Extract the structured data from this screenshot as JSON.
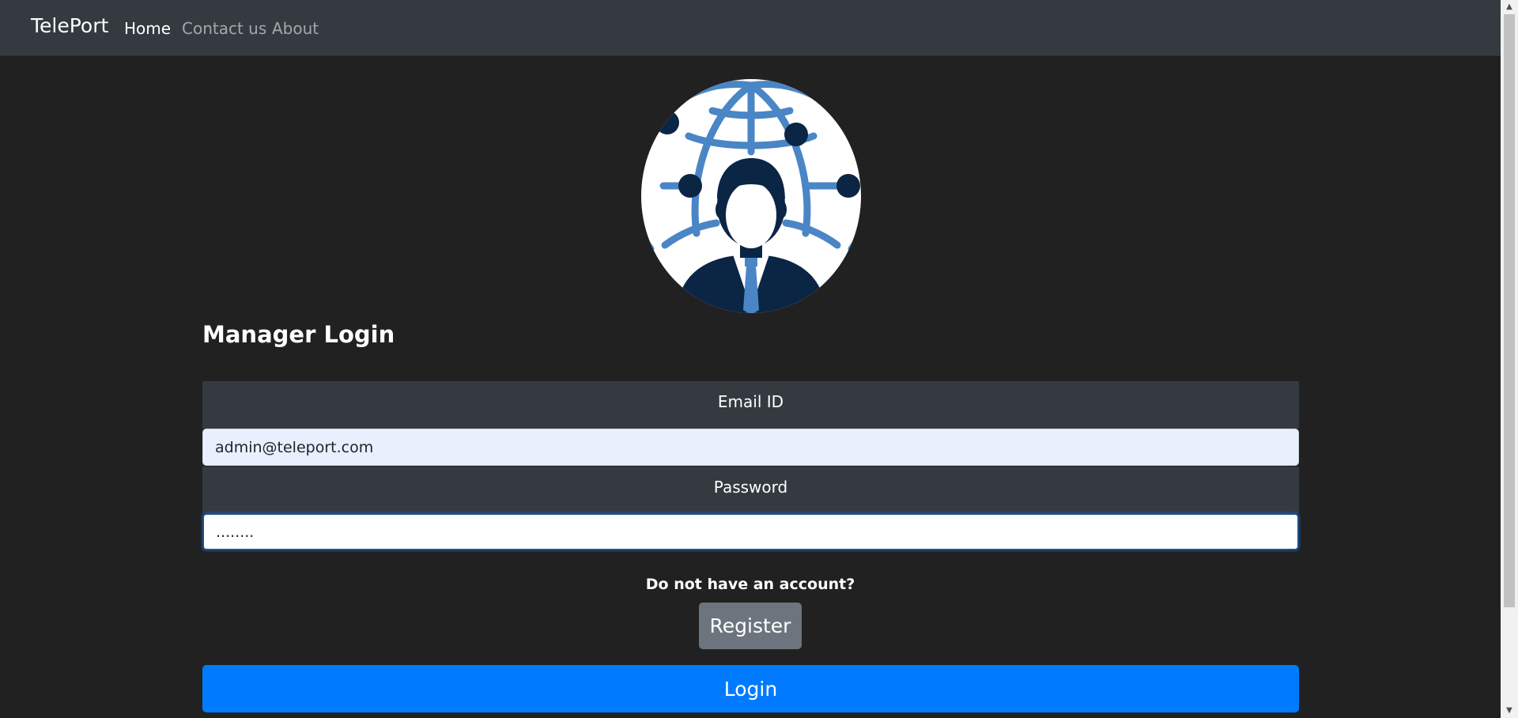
{
  "navbar": {
    "brand": "TelePort",
    "links": [
      "Home",
      "Contact us",
      "About"
    ]
  },
  "login": {
    "title": "Manager Login",
    "email_label": "Email ID",
    "email_value": "admin@teleport.com",
    "password_label": "Password",
    "password_value": "........",
    "no_account_text": "Do not have an account?",
    "register_label": "Register",
    "login_label": "Login"
  },
  "colors": {
    "page_bg": "#212121",
    "navbar_bg": "#343a40",
    "login_button": "#007bff",
    "register_button": "#6c757d",
    "logo_blue": "#4a86c5",
    "logo_navy": "#0b2545"
  },
  "icons": {
    "avatar": "manager-globe-icon"
  }
}
